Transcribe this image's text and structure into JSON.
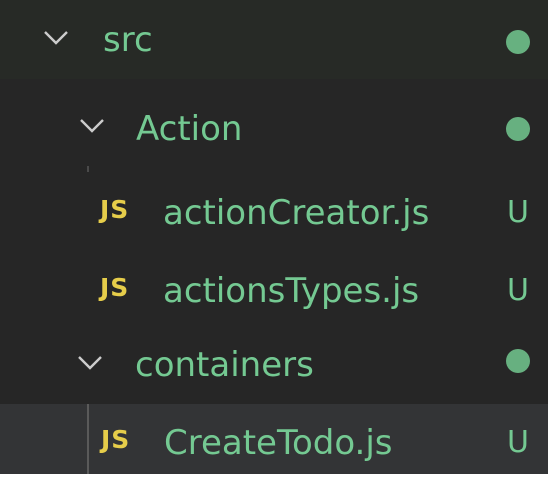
{
  "explorer": {
    "items": [
      {
        "label": "src",
        "type": "folder",
        "expanded": true,
        "icon": "chevron-down-icon",
        "status": "dot"
      },
      {
        "label": "Action",
        "type": "folder",
        "expanded": true,
        "icon": "chevron-down-icon",
        "status": "dot"
      },
      {
        "label": "actionCreator.js",
        "type": "file",
        "icon_text": "JS",
        "status": "U"
      },
      {
        "label": "actionsTypes.js",
        "type": "file",
        "icon_text": "JS",
        "status": "U"
      },
      {
        "label": "containers",
        "type": "folder",
        "expanded": true,
        "icon": "chevron-down-icon",
        "status": "dot"
      },
      {
        "label": "CreateTodo.js",
        "type": "file",
        "icon_text": "JS",
        "status": "U",
        "selected": true
      }
    ]
  },
  "colors": {
    "background": "#262626",
    "selected_row": "#333436",
    "untracked_text": "#74c992",
    "js_icon": "#e6cd4a",
    "chevron": "#cccccc"
  }
}
